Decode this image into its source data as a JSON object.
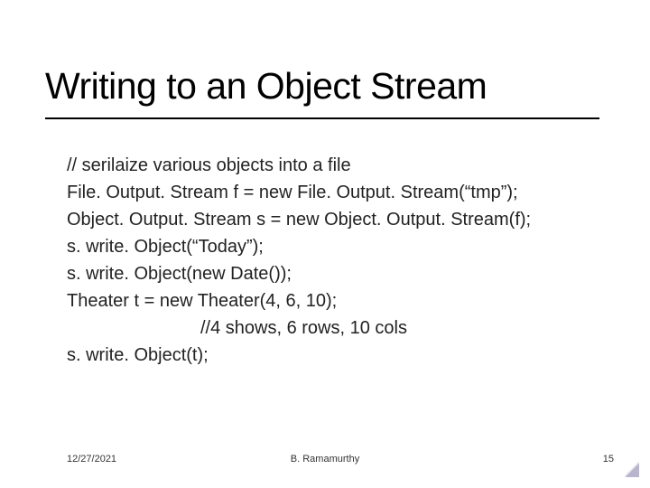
{
  "title": "Writing to an Object Stream",
  "code": {
    "l1": "// serilaize various objects into a file",
    "l2": "File. Output. Stream f = new File. Output. Stream(“tmp”);",
    "l3": "Object. Output. Stream s = new Object. Output. Stream(f);",
    "l4": "s. write. Object(“Today”);",
    "l5": "s. write. Object(new Date());",
    "l6": "Theater t = new Theater(4, 6, 10);",
    "l7": "//4 shows, 6 rows, 10 cols",
    "l8": "s. write. Object(t);"
  },
  "footer": {
    "date": "12/27/2021",
    "author": "B. Ramamurthy",
    "page": "15"
  }
}
